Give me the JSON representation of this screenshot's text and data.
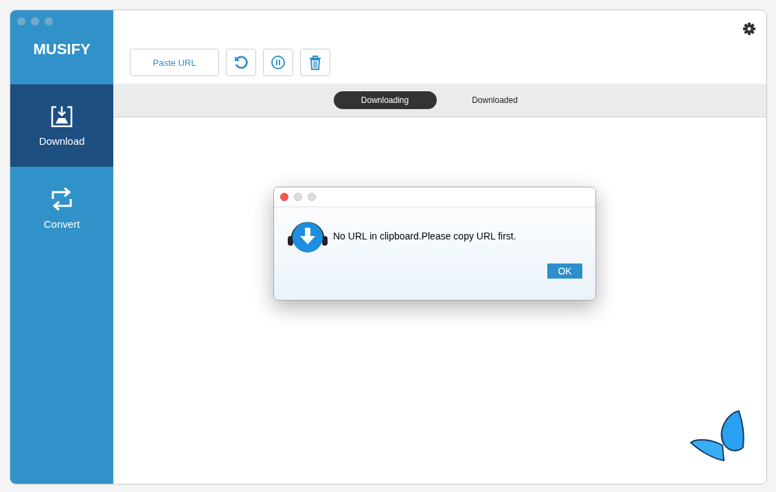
{
  "app": {
    "logo": "MUSIFY"
  },
  "sidebar": {
    "items": [
      {
        "label": "Download",
        "kind": "download",
        "selected": true
      },
      {
        "label": "Convert",
        "kind": "convert",
        "selected": false
      }
    ]
  },
  "toolbar": {
    "paste_button": "Paste URL",
    "icons": [
      {
        "kind": "refresh"
      },
      {
        "kind": "pause"
      },
      {
        "kind": "trash"
      }
    ]
  },
  "tabs": [
    {
      "label": "Downloading",
      "selected": true
    },
    {
      "label": "Downloaded",
      "selected": false
    }
  ],
  "dialog": {
    "message": "No URL in clipboard.Please copy URL first.",
    "button": "OK"
  }
}
